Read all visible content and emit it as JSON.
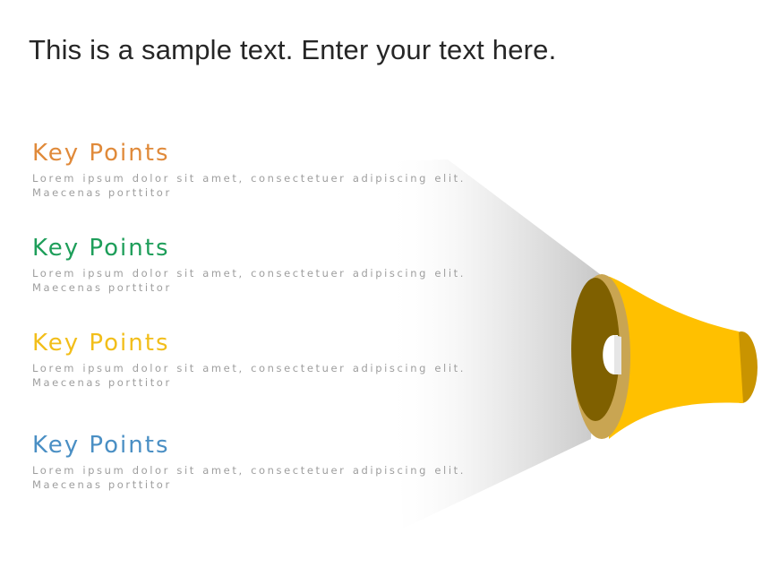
{
  "slide": {
    "title": "This is a sample text. Enter your text here.",
    "key_points": [
      {
        "heading": "Key Points",
        "color": "#E08A3A",
        "body": "Lorem ipsum dolor sit amet, consectetuer adipiscing elit. Maecenas porttitor"
      },
      {
        "heading": "Key Points",
        "color": "#1E9E5A",
        "body": "Lorem ipsum dolor sit amet, consectetuer adipiscing elit. Maecenas porttitor"
      },
      {
        "heading": "Key Points",
        "color": "#F2BE1A",
        "body": "Lorem ipsum dolor sit amet, consectetuer adipiscing elit. Maecenas porttitor"
      },
      {
        "heading": "Key Points",
        "color": "#4A8FC4",
        "body": "Lorem ipsum dolor sit amet, consectetuer adipiscing elit. Maecenas porttitor"
      }
    ],
    "megaphone_colors": {
      "body": "#FFC000",
      "rim_dark": "#7F6000",
      "rim_light": "#C9A552",
      "mouthpiece": "#C99400"
    }
  }
}
